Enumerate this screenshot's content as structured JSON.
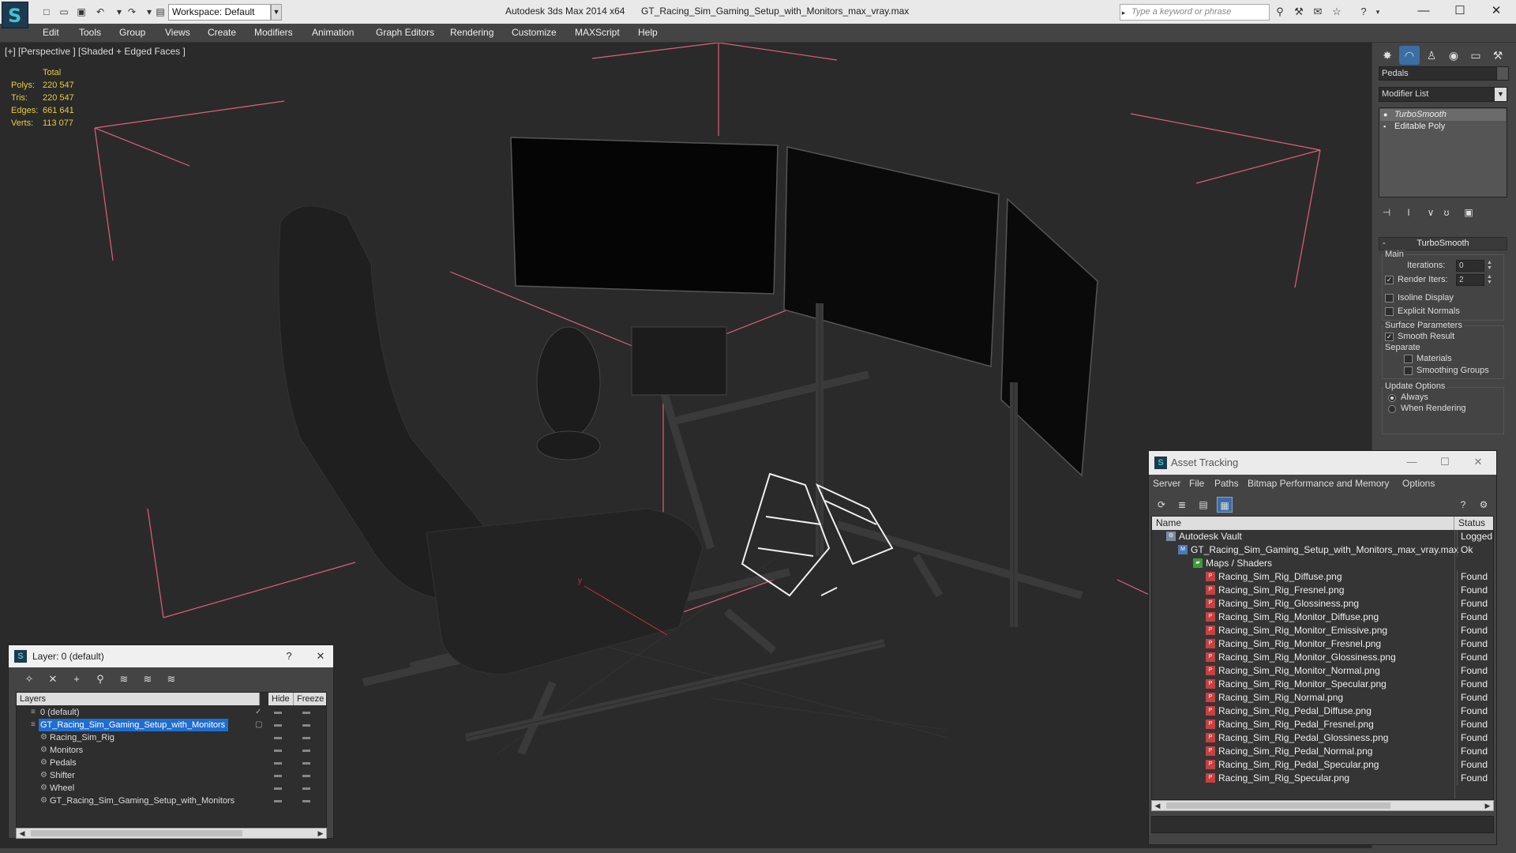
{
  "app": {
    "title": "Autodesk 3ds Max  2014 x64",
    "file": "GT_Racing_Sim_Gaming_Setup_with_Monitors_max_vray.max",
    "logo_glyph": "S",
    "workspace": "Workspace: Default",
    "search_placeholder": "Type a keyword or phrase"
  },
  "menu": [
    "Edit",
    "Tools",
    "Group",
    "Views",
    "Create",
    "Modifiers",
    "Animation",
    "Graph Editors",
    "Rendering",
    "Customize",
    "MAXScript",
    "Help"
  ],
  "viewport": {
    "label": "[+] [Perspective ] [Shaded + Edged Faces ]",
    "stats": {
      "header": "Total",
      "rows": [
        {
          "label": "Polys:",
          "value": "220 547"
        },
        {
          "label": "Tris:",
          "value": "220 547"
        },
        {
          "label": "Edges:",
          "value": "661 641"
        },
        {
          "label": "Verts:",
          "value": "113 077"
        }
      ]
    },
    "axis_label": "y"
  },
  "command_panel": {
    "object_name": "Pedals",
    "modifier_list": "Modifier List",
    "stack": [
      "TurboSmooth",
      "Editable Poly"
    ],
    "rollout": "TurboSmooth",
    "main_label": "Main",
    "iterations_label": "Iterations:",
    "iterations": "0",
    "render_iters_label": "Render Iters:",
    "render_iters": "2",
    "isoline": "Isoline Display",
    "explicit_normals": "Explicit Normals",
    "surface_params": "Surface Parameters",
    "smooth_result": "Smooth Result",
    "separate": "Separate",
    "materials": "Materials",
    "smoothing_groups": "Smoothing Groups",
    "update_options": "Update Options",
    "always": "Always",
    "when_rendering": "When Rendering"
  },
  "layer_dialog": {
    "title": "Layer: 0 (default)",
    "help": "?",
    "columns": [
      "Layers",
      "Hide",
      "Freeze"
    ],
    "rows": [
      {
        "name": "0 (default)",
        "indent": 0,
        "selected": false
      },
      {
        "name": "GT_Racing_Sim_Gaming_Setup_with_Monitors",
        "indent": 0,
        "selected": true
      },
      {
        "name": "Racing_Sim_Rig",
        "indent": 1,
        "selected": false
      },
      {
        "name": "Monitors",
        "indent": 1,
        "selected": false
      },
      {
        "name": "Pedals",
        "indent": 1,
        "selected": false
      },
      {
        "name": "Shifter",
        "indent": 1,
        "selected": false
      },
      {
        "name": "Wheel",
        "indent": 1,
        "selected": false
      },
      {
        "name": "GT_Racing_Sim_Gaming_Setup_with_Monitors",
        "indent": 1,
        "selected": false
      }
    ]
  },
  "asset_dialog": {
    "title": "Asset Tracking",
    "menu": [
      "Server",
      "File",
      "Paths",
      "Bitmap Performance and Memory",
      "Options"
    ],
    "columns": [
      "Name",
      "Status"
    ],
    "rows": [
      {
        "name": "Autodesk Vault",
        "status": "Logged O",
        "level": 0,
        "icon": "vault"
      },
      {
        "name": "GT_Racing_Sim_Gaming_Setup_with_Monitors_max_vray.max",
        "status": "Ok",
        "level": 1,
        "icon": "max"
      },
      {
        "name": "Maps / Shaders",
        "status": "",
        "level": 2,
        "icon": "folder"
      },
      {
        "name": "Racing_Sim_Rig_Diffuse.png",
        "status": "Found",
        "level": 3,
        "icon": "png"
      },
      {
        "name": "Racing_Sim_Rig_Fresnel.png",
        "status": "Found",
        "level": 3,
        "icon": "png"
      },
      {
        "name": "Racing_Sim_Rig_Glossiness.png",
        "status": "Found",
        "level": 3,
        "icon": "png"
      },
      {
        "name": "Racing_Sim_Rig_Monitor_Diffuse.png",
        "status": "Found",
        "level": 3,
        "icon": "png"
      },
      {
        "name": "Racing_Sim_Rig_Monitor_Emissive.png",
        "status": "Found",
        "level": 3,
        "icon": "png"
      },
      {
        "name": "Racing_Sim_Rig_Monitor_Fresnel.png",
        "status": "Found",
        "level": 3,
        "icon": "png"
      },
      {
        "name": "Racing_Sim_Rig_Monitor_Glossiness.png",
        "status": "Found",
        "level": 3,
        "icon": "png"
      },
      {
        "name": "Racing_Sim_Rig_Monitor_Normal.png",
        "status": "Found",
        "level": 3,
        "icon": "png"
      },
      {
        "name": "Racing_Sim_Rig_Monitor_Specular.png",
        "status": "Found",
        "level": 3,
        "icon": "png"
      },
      {
        "name": "Racing_Sim_Rig_Normal.png",
        "status": "Found",
        "level": 3,
        "icon": "png"
      },
      {
        "name": "Racing_Sim_Rig_Pedal_Diffuse.png",
        "status": "Found",
        "level": 3,
        "icon": "png"
      },
      {
        "name": "Racing_Sim_Rig_Pedal_Fresnel.png",
        "status": "Found",
        "level": 3,
        "icon": "png"
      },
      {
        "name": "Racing_Sim_Rig_Pedal_Glossiness.png",
        "status": "Found",
        "level": 3,
        "icon": "png"
      },
      {
        "name": "Racing_Sim_Rig_Pedal_Normal.png",
        "status": "Found",
        "level": 3,
        "icon": "png"
      },
      {
        "name": "Racing_Sim_Rig_Pedal_Specular.png",
        "status": "Found",
        "level": 3,
        "icon": "png"
      },
      {
        "name": "Racing_Sim_Rig_Specular.png",
        "status": "Found",
        "level": 3,
        "icon": "png"
      }
    ]
  },
  "colors": {
    "stats": "#e5cc3c",
    "selection": "#1e6ed2",
    "accent": "#3b6ea5",
    "bbox": "#e0607a"
  }
}
